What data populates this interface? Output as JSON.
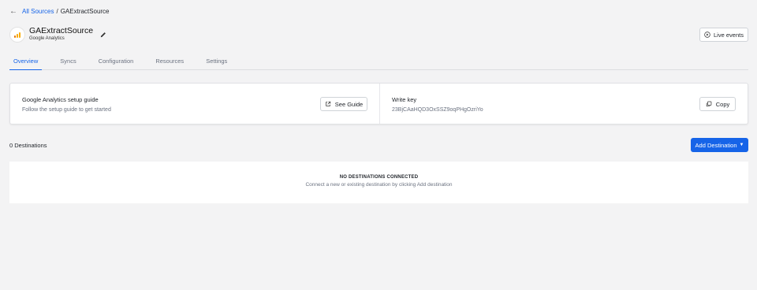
{
  "breadcrumb": {
    "back_icon": "arrow-left-icon",
    "parent": "All Sources",
    "separator": "/",
    "current": "GAExtractSource"
  },
  "source": {
    "name": "GAExtractSource",
    "type": "Google Analytics",
    "logo": "google-analytics-logo",
    "edit_icon": "pencil-icon"
  },
  "live_events": {
    "label": "Live events",
    "icon": "play-circle-icon"
  },
  "tabs": [
    {
      "label": "Overview",
      "active": true
    },
    {
      "label": "Syncs"
    },
    {
      "label": "Configuration"
    },
    {
      "label": "Resources"
    },
    {
      "label": "Settings"
    }
  ],
  "guide": {
    "title": "Google Analytics setup guide",
    "subtitle": "Follow the setup guide to get started",
    "button": "See Guide",
    "button_icon": "external-link-icon"
  },
  "write_key": {
    "title": "Write key",
    "value": "23BjCAaHQD3OxSSZ9oqPHgOzriYo",
    "button": "Copy",
    "button_icon": "copy-icon"
  },
  "destinations": {
    "count_label": "0 Destinations",
    "add_button": "Add Destination",
    "empty_title": "NO DESTINATIONS CONNECTED",
    "empty_subtitle": "Connect a new or existing destination by clicking Add destination"
  },
  "colors": {
    "primary": "#1664e8",
    "background": "#f3f3f4",
    "card": "#ffffff",
    "ga_orange": "#f9ab00"
  }
}
